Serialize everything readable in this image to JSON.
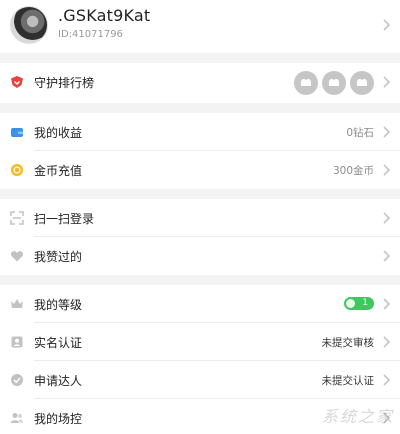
{
  "profile": {
    "username": ".GSKat9Kat",
    "user_id": "ID:41071796"
  },
  "menu_groups": [
    [
      {
        "label": "守护排行榜",
        "icon": "guard-ranking-icon"
      }
    ],
    [
      {
        "label": "我的收益",
        "value": "0钻石",
        "icon": "wallet-icon"
      },
      {
        "label": "金币充值",
        "value": "300金币",
        "icon": "coin-icon"
      }
    ],
    [
      {
        "label": "扫一扫登录",
        "icon": "scan-icon"
      },
      {
        "label": "我赞过的",
        "icon": "heart-icon"
      }
    ],
    [
      {
        "label": "我的等级",
        "level": "1",
        "icon": "crown-icon"
      },
      {
        "label": "实名认证",
        "value": "未提交审核",
        "icon": "id-card-icon"
      },
      {
        "label": "申请达人",
        "value": "未提交认证",
        "icon": "verified-badge-icon"
      },
      {
        "label": "我的场控",
        "icon": "user-group-icon"
      }
    ]
  ],
  "colors": {
    "accent_green": "#3ec862",
    "guard_icon_red": "#e2463f",
    "wallet_blue": "#3a93e6",
    "coin_yellow": "#f5b81f",
    "icon_gray": "#c2c2c2"
  },
  "watermark": {
    "text": "系统之家"
  }
}
